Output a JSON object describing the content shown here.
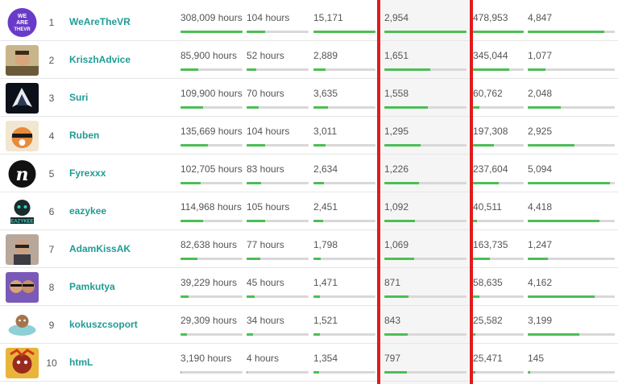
{
  "theme": {
    "accent": "#1f9c94",
    "bar_fill": "#4cbe55",
    "bar_track": "#d8d8d8",
    "annotation": "#e01b1b"
  },
  "rows": [
    {
      "rank": "1",
      "name": "WeAreTheVR",
      "avatar": "wearethevr-logo",
      "cells": [
        {
          "text": "308,009 hours",
          "fill": 1.0
        },
        {
          "text": "104 hours",
          "fill": 0.3
        },
        {
          "text": "15,171",
          "fill": 1.0
        },
        {
          "text": "2,954",
          "fill": 1.0
        },
        {
          "text": "478,953",
          "fill": 1.0
        },
        {
          "text": "4,847",
          "fill": 0.88
        }
      ]
    },
    {
      "rank": "2",
      "name": "KriszhAdvice",
      "avatar": "kriszhadvice-avatar",
      "cells": [
        {
          "text": "85,900 hours",
          "fill": 0.28
        },
        {
          "text": "52 hours",
          "fill": 0.15
        },
        {
          "text": "2,889",
          "fill": 0.2
        },
        {
          "text": "1,651",
          "fill": 0.56
        },
        {
          "text": "345,044",
          "fill": 0.72
        },
        {
          "text": "1,077",
          "fill": 0.2
        }
      ]
    },
    {
      "rank": "3",
      "name": "Suri",
      "avatar": "suri-avatar",
      "cells": [
        {
          "text": "109,900 hours",
          "fill": 0.36
        },
        {
          "text": "70 hours",
          "fill": 0.2
        },
        {
          "text": "3,635",
          "fill": 0.24
        },
        {
          "text": "1,558",
          "fill": 0.53
        },
        {
          "text": "60,762",
          "fill": 0.13
        },
        {
          "text": "2,048",
          "fill": 0.38
        }
      ]
    },
    {
      "rank": "4",
      "name": "Ruben",
      "avatar": "ruben-avatar",
      "cells": [
        {
          "text": "135,669 hours",
          "fill": 0.44
        },
        {
          "text": "104 hours",
          "fill": 0.3
        },
        {
          "text": "3,011",
          "fill": 0.2
        },
        {
          "text": "1,295",
          "fill": 0.44
        },
        {
          "text": "197,308",
          "fill": 0.41
        },
        {
          "text": "2,925",
          "fill": 0.54
        }
      ]
    },
    {
      "rank": "5",
      "name": "Fyrexxx",
      "avatar": "fyrexxx-avatar",
      "cells": [
        {
          "text": "102,705 hours",
          "fill": 0.33
        },
        {
          "text": "83 hours",
          "fill": 0.24
        },
        {
          "text": "2,634",
          "fill": 0.17
        },
        {
          "text": "1,226",
          "fill": 0.42
        },
        {
          "text": "237,604",
          "fill": 0.5
        },
        {
          "text": "5,094",
          "fill": 0.94
        }
      ]
    },
    {
      "rank": "6",
      "name": "eazykee",
      "avatar": "eazykee-avatar",
      "cells": [
        {
          "text": "114,968 hours",
          "fill": 0.37
        },
        {
          "text": "105 hours",
          "fill": 0.3
        },
        {
          "text": "2,451",
          "fill": 0.16
        },
        {
          "text": "1,092",
          "fill": 0.37
        },
        {
          "text": "40,511",
          "fill": 0.08
        },
        {
          "text": "4,418",
          "fill": 0.82
        }
      ]
    },
    {
      "rank": "7",
      "name": "AdamKissAK",
      "avatar": "adamkissak-avatar",
      "cells": [
        {
          "text": "82,638 hours",
          "fill": 0.27
        },
        {
          "text": "77 hours",
          "fill": 0.22
        },
        {
          "text": "1,798",
          "fill": 0.12
        },
        {
          "text": "1,069",
          "fill": 0.36
        },
        {
          "text": "163,735",
          "fill": 0.34
        },
        {
          "text": "1,247",
          "fill": 0.23
        }
      ]
    },
    {
      "rank": "8",
      "name": "Pamkutya",
      "avatar": "pamkutya-avatar",
      "cells": [
        {
          "text": "39,229 hours",
          "fill": 0.13
        },
        {
          "text": "45 hours",
          "fill": 0.13
        },
        {
          "text": "1,471",
          "fill": 0.1
        },
        {
          "text": "871",
          "fill": 0.29
        },
        {
          "text": "58,635",
          "fill": 0.12
        },
        {
          "text": "4,162",
          "fill": 0.77
        }
      ]
    },
    {
      "rank": "9",
      "name": "kokuszcsoport",
      "avatar": "kokuszcsoport-avatar",
      "cells": [
        {
          "text": "29,309 hours",
          "fill": 0.1
        },
        {
          "text": "34 hours",
          "fill": 0.1
        },
        {
          "text": "1,521",
          "fill": 0.1
        },
        {
          "text": "843",
          "fill": 0.28
        },
        {
          "text": "25,582",
          "fill": 0.05
        },
        {
          "text": "3,199",
          "fill": 0.59
        }
      ]
    },
    {
      "rank": "10",
      "name": "htmL",
      "avatar": "html-avatar",
      "cells": [
        {
          "text": "3,190 hours",
          "fill": 0.01
        },
        {
          "text": "4 hours",
          "fill": 0.01
        },
        {
          "text": "1,354",
          "fill": 0.09
        },
        {
          "text": "797",
          "fill": 0.27
        },
        {
          "text": "25,471",
          "fill": 0.05
        },
        {
          "text": "145",
          "fill": 0.03
        }
      ]
    }
  ]
}
